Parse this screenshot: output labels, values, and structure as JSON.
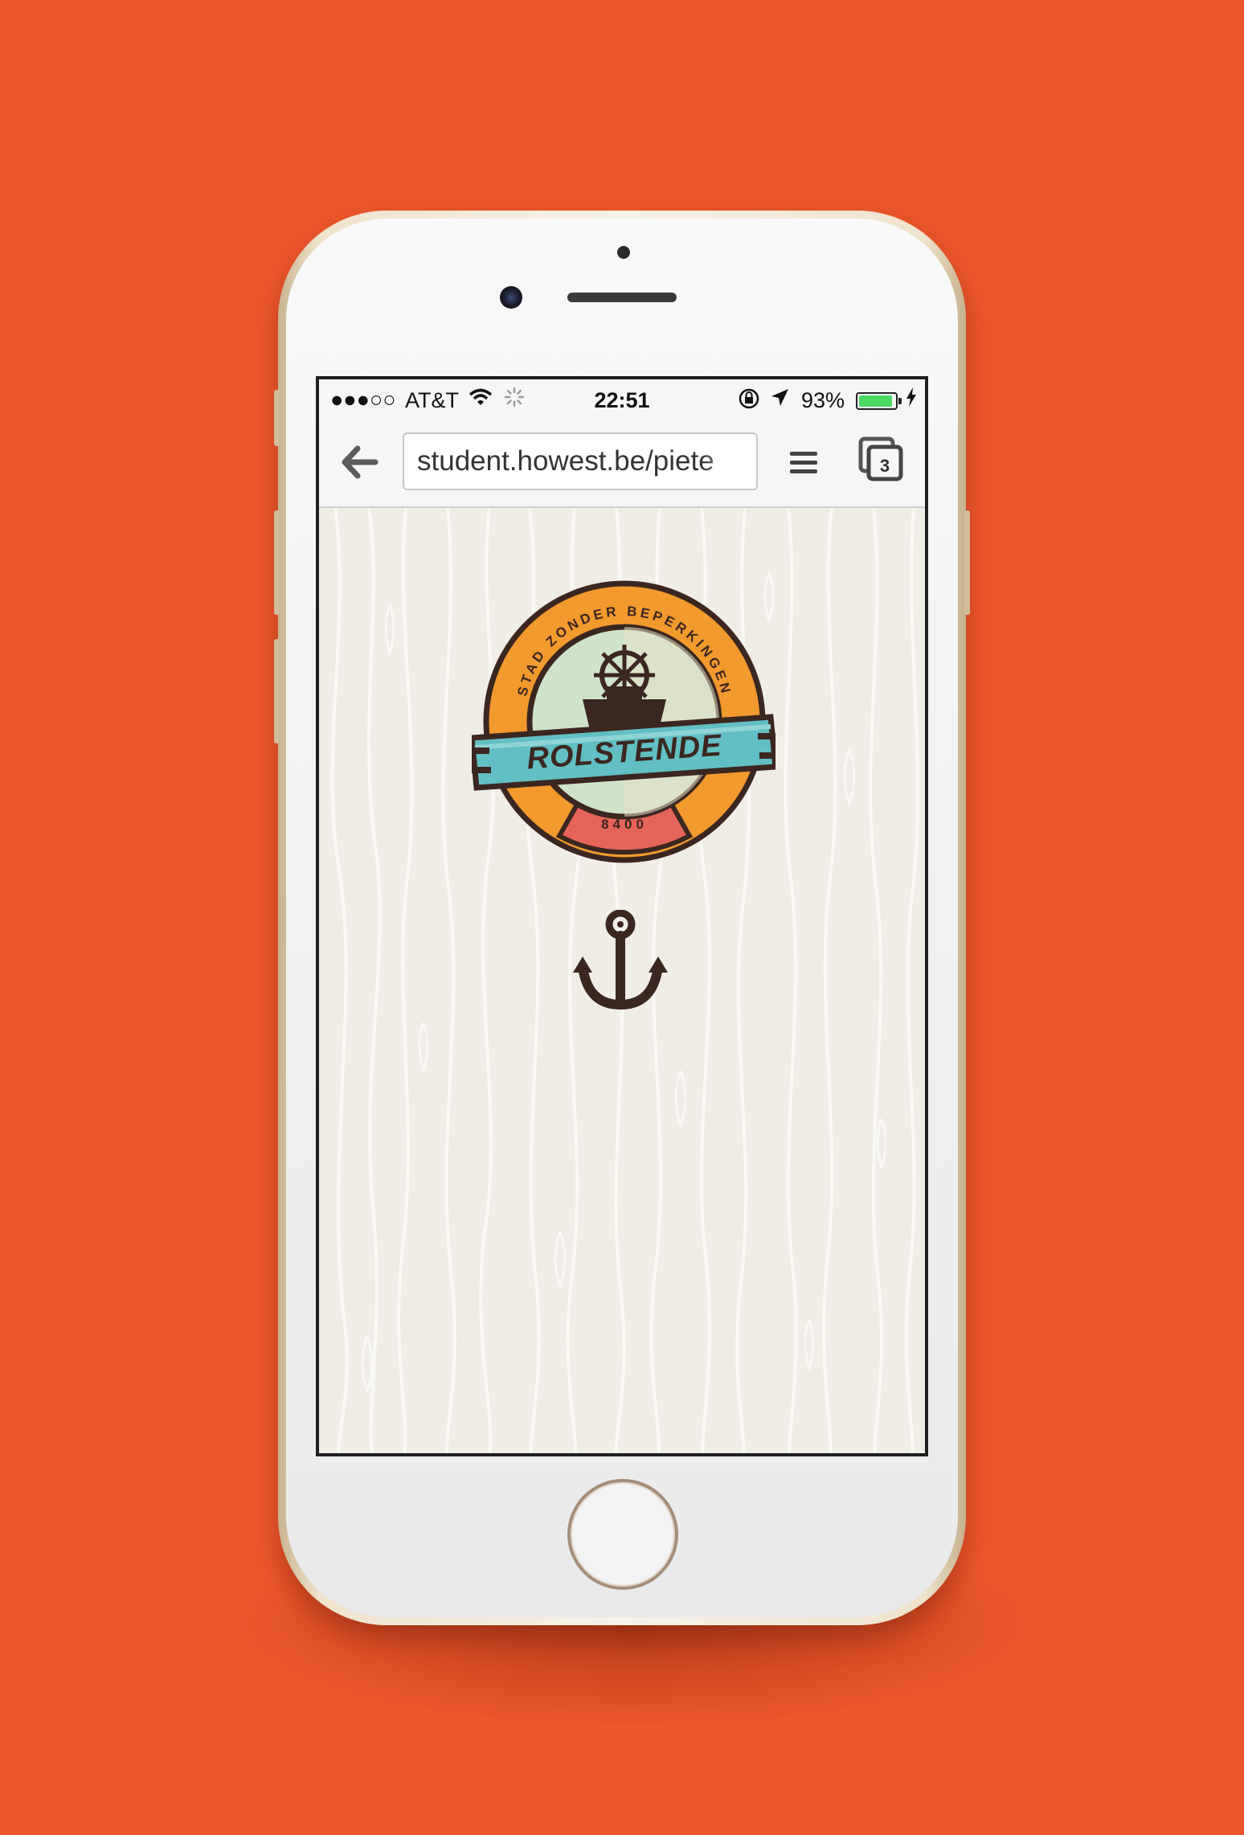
{
  "status_bar": {
    "signal": "●●●○○",
    "carrier": "AT&T",
    "wifi_icon": "wifi-icon",
    "activity_icon": "loading-spinner-icon",
    "time": "22:51",
    "lock_icon": "orientation-lock-icon",
    "location_icon": "location-arrow-icon",
    "battery_percent": "93%",
    "battery_level": 0.93,
    "charging_icon": "charging-bolt-icon",
    "battery_color": "#4CD964"
  },
  "browser": {
    "back_icon": "back-arrow-icon",
    "url": "student.howest.be/piete",
    "menu_icon": "hamburger-menu-icon",
    "tab_count": "3"
  },
  "page": {
    "logo": {
      "arc_text": "STAD ZONDER BEPERKINGEN",
      "banner_text": "ROLSTENDE",
      "postal_code": "8400"
    },
    "anchor_icon": "anchor-icon"
  },
  "colors": {
    "background": "#EB562B",
    "logo_orange": "#F29A2E",
    "logo_teal": "#62BFC3",
    "logo_red": "#E5645A",
    "logo_dark": "#3B2620",
    "page_bg": "#EFEDE6"
  }
}
